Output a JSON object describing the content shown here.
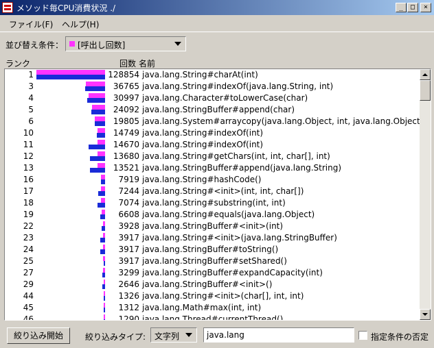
{
  "window": {
    "title": "メソッド毎CPU消費状況 ./",
    "minimize_glyph": "_",
    "maximize_glyph": "□",
    "close_glyph": "×"
  },
  "menu": {
    "file": "ファイル(F)",
    "help": "ヘルプ(H)"
  },
  "sort": {
    "label": "並び替え条件：",
    "selected": "[呼出し回数]",
    "swatch_color": "#ff33ff"
  },
  "columns": {
    "rank": "ランク",
    "count": "回数",
    "name": "名前"
  },
  "bar_colors": {
    "calls": "#ff33ff",
    "cpu": "#1a2bd8"
  },
  "rows": [
    {
      "rank": "1",
      "count": "128854",
      "name": "java.lang.String#charAt(int)",
      "calls": 1.0,
      "cpu": 1.0
    },
    {
      "rank": "3",
      "count": "36765",
      "name": "java.lang.String#indexOf(java.lang.String, int)",
      "calls": 0.285,
      "cpu": 0.29
    },
    {
      "rank": "4",
      "count": "30997",
      "name": "java.lang.Character#toLowerCase(char)",
      "calls": 0.24,
      "cpu": 0.26
    },
    {
      "rank": "5",
      "count": "24092",
      "name": "java.lang.StringBuffer#append(char)",
      "calls": 0.187,
      "cpu": 0.2
    },
    {
      "rank": "6",
      "count": "19805",
      "name": "java.lang.System#arraycopy(java.lang.Object, int, java.lang.Object, int, int)",
      "calls": 0.154,
      "cpu": 0.15
    },
    {
      "rank": "10",
      "count": "14749",
      "name": "java.lang.String#indexOf(int)",
      "calls": 0.114,
      "cpu": 0.12
    },
    {
      "rank": "11",
      "count": "14670",
      "name": "java.lang.String#indexOf(int)",
      "calls": 0.114,
      "cpu": 0.24
    },
    {
      "rank": "12",
      "count": "13680",
      "name": "java.lang.String#getChars(int, int, char[], int)",
      "calls": 0.106,
      "cpu": 0.22
    },
    {
      "rank": "13",
      "count": "13521",
      "name": "java.lang.StringBuffer#append(java.lang.String)",
      "calls": 0.105,
      "cpu": 0.22
    },
    {
      "rank": "16",
      "count": "7919",
      "name": "java.lang.String#hashCode()",
      "calls": 0.061,
      "cpu": 0.06
    },
    {
      "rank": "17",
      "count": "7244",
      "name": "java.lang.String#<init>(int, int, char[])",
      "calls": 0.056,
      "cpu": 0.1
    },
    {
      "rank": "18",
      "count": "7074",
      "name": "java.lang.String#substring(int, int)",
      "calls": 0.055,
      "cpu": 0.11
    },
    {
      "rank": "19",
      "count": "6608",
      "name": "java.lang.String#equals(java.lang.Object)",
      "calls": 0.051,
      "cpu": 0.07
    },
    {
      "rank": "22",
      "count": "3928",
      "name": "java.lang.StringBuffer#<init>(int)",
      "calls": 0.03,
      "cpu": 0.05
    },
    {
      "rank": "23",
      "count": "3917",
      "name": "java.lang.String#<init>(java.lang.StringBuffer)",
      "calls": 0.03,
      "cpu": 0.07
    },
    {
      "rank": "24",
      "count": "3917",
      "name": "java.lang.StringBuffer#toString()",
      "calls": 0.03,
      "cpu": 0.07
    },
    {
      "rank": "25",
      "count": "3917",
      "name": "java.lang.StringBuffer#setShared()",
      "calls": 0.03,
      "cpu": 0.02
    },
    {
      "rank": "27",
      "count": "3299",
      "name": "java.lang.StringBuffer#expandCapacity(int)",
      "calls": 0.026,
      "cpu": 0.04
    },
    {
      "rank": "29",
      "count": "2646",
      "name": "java.lang.StringBuffer#<init>()",
      "calls": 0.021,
      "cpu": 0.04
    },
    {
      "rank": "44",
      "count": "1326",
      "name": "java.lang.String#<init>(char[], int, int)",
      "calls": 0.01,
      "cpu": 0.02
    },
    {
      "rank": "45",
      "count": "1312",
      "name": "java.lang.Math#max(int, int)",
      "calls": 0.01,
      "cpu": 0.02
    },
    {
      "rank": "46",
      "count": "1290",
      "name": "java.lang.Thread#currentThread()",
      "calls": 0.01,
      "cpu": 0.02
    }
  ],
  "bottom": {
    "filter_button": "絞り込み開始",
    "filter_type_label": "絞り込みタイプ:",
    "filter_type_value": "文字列",
    "filter_text": "java.lang",
    "negate_label": "指定条件の否定"
  }
}
